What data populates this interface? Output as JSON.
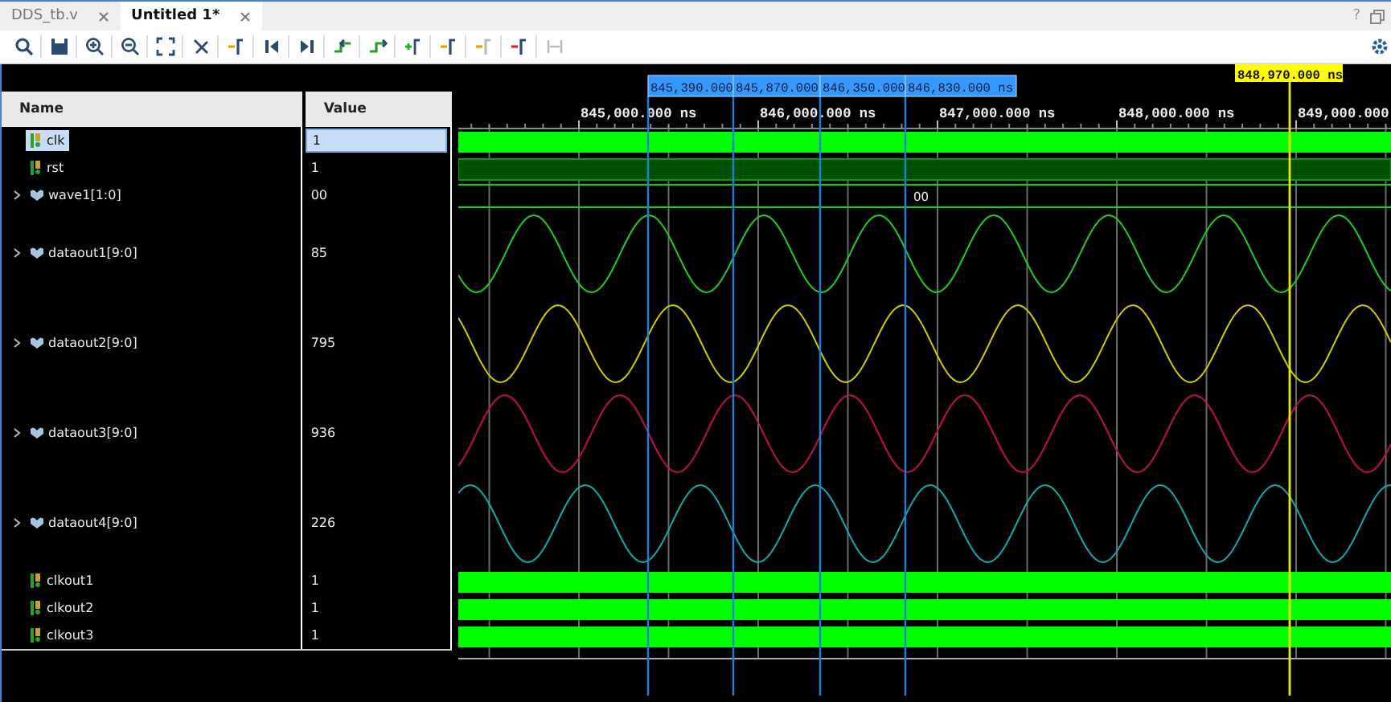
{
  "tabs": [
    {
      "label": "DDS_tb.v",
      "selected": false
    },
    {
      "label": "Untitled 1*",
      "selected": true
    }
  ],
  "help": "?",
  "toolbar": [
    {
      "kind": "search",
      "disabled": false
    },
    {
      "kind": "save",
      "disabled": false
    },
    {
      "kind": "zoom-in",
      "disabled": false
    },
    {
      "kind": "zoom-out",
      "disabled": false
    },
    {
      "kind": "fit",
      "disabled": false
    },
    {
      "kind": "snap",
      "disabled": false
    },
    {
      "kind": "go-marker",
      "disabled": false
    },
    {
      "kind": "first",
      "disabled": false
    },
    {
      "kind": "last",
      "disabled": false
    },
    {
      "kind": "prev-edge",
      "disabled": false
    },
    {
      "kind": "next-edge",
      "disabled": false
    },
    {
      "kind": "add-marker",
      "disabled": false
    },
    {
      "kind": "prev-marker",
      "disabled": false
    },
    {
      "kind": "next-marker",
      "disabled": true
    },
    {
      "kind": "delete-marker",
      "disabled": false
    },
    {
      "kind": "swap",
      "disabled": true
    }
  ],
  "columns": [
    "Name",
    "Value"
  ],
  "signals": [
    {
      "name": "clk",
      "value": "1",
      "kind": "bit",
      "selected": true,
      "color": "#00ff00"
    },
    {
      "name": "rst",
      "value": "1",
      "kind": "bit",
      "selected": false,
      "color": "#005000"
    },
    {
      "name": "wave1[1:0]",
      "value": "00",
      "kind": "bus",
      "selected": false,
      "expanded": false,
      "color": "#00e000",
      "bus_label": "00"
    },
    {
      "name": "dataout1[9:0]",
      "value": "85",
      "kind": "analog",
      "selected": false,
      "expanded": false,
      "color": "#22cc22"
    },
    {
      "name": "dataout2[9:0]",
      "value": "795",
      "kind": "analog",
      "selected": false,
      "expanded": false,
      "color": "#cccc00"
    },
    {
      "name": "dataout3[9:0]",
      "value": "936",
      "kind": "analog",
      "selected": false,
      "expanded": false,
      "color": "#c0104a"
    },
    {
      "name": "dataout4[9:0]",
      "value": "226",
      "kind": "analog",
      "selected": false,
      "expanded": false,
      "color": "#13aaaa"
    },
    {
      "name": "clkout1",
      "value": "1",
      "kind": "bit",
      "selected": false,
      "color": "#00ff00"
    },
    {
      "name": "clkout2",
      "value": "1",
      "kind": "bit",
      "selected": false,
      "color": "#00ff00"
    },
    {
      "name": "clkout3",
      "value": "1",
      "kind": "bit",
      "selected": false,
      "color": "#00ff00"
    }
  ],
  "timeline": {
    "ticks": [
      "845,000.000 ns",
      "846,000.000 ns",
      "847,000.000 ns",
      "848,000.000 ns",
      "849,000.000"
    ],
    "markers": [
      "845,390.000",
      "845,870.000",
      "846,350.000",
      "846,830.000 ns"
    ],
    "cursor": "848,970.000 ns"
  }
}
